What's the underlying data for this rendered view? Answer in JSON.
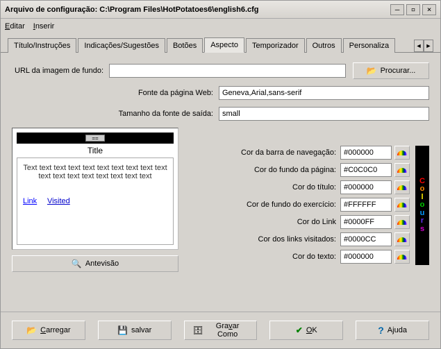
{
  "title": "Arquivo de configuração: C:\\Program Files\\HotPotatoes6\\english6.cfg",
  "menu": {
    "edit": "Editar",
    "insert": "Inserir"
  },
  "tabs": {
    "items": [
      "Título/Instruções",
      "Indicações/Sugestões",
      "Botões",
      "Aspecto",
      "Temporizador",
      "Outros",
      "Personaliza"
    ],
    "active": "Aspecto"
  },
  "fields": {
    "url_label": "URL da imagem de fundo:",
    "url_value": "",
    "browse": "Procurar...",
    "font_label": "Fonte da página Web:",
    "font_value": "Geneva,Arial,sans-serif",
    "size_label": "Tamanho da fonte de saída:",
    "size_value": "small"
  },
  "preview": {
    "nav_seg": "==",
    "title": "Title",
    "body": "Text text text text text text text text text text text text text text text text text text",
    "link": "Link",
    "visited": "Visited",
    "btn": "Antevisão"
  },
  "colors": {
    "rows": [
      {
        "label": "Cor da barra de navegação:",
        "value": "#000000"
      },
      {
        "label": "Cor do fundo da página:",
        "value": "#C0C0C0"
      },
      {
        "label": "Cor do título:",
        "value": "#000000"
      },
      {
        "label": "Cor de fundo do exercício:",
        "value": "#FFFFFF"
      },
      {
        "label": "Cor do Link",
        "value": "#0000FF"
      },
      {
        "label": "Cor dos links visitados:",
        "value": "#0000CC"
      },
      {
        "label": "Cor do texto:",
        "value": "#000000"
      }
    ],
    "vbar": [
      "C",
      "o",
      "l",
      "o",
      "u",
      "r",
      "s"
    ],
    "vbar_colors": [
      "#ff0000",
      "#ff8800",
      "#ffee00",
      "#00cc00",
      "#0099ff",
      "#6633ff",
      "#cc00cc"
    ]
  },
  "bottom": {
    "load": "Carregar",
    "save": "salvar",
    "saveas": "Gravar Como",
    "ok": "OK",
    "help": "Ajuda"
  }
}
